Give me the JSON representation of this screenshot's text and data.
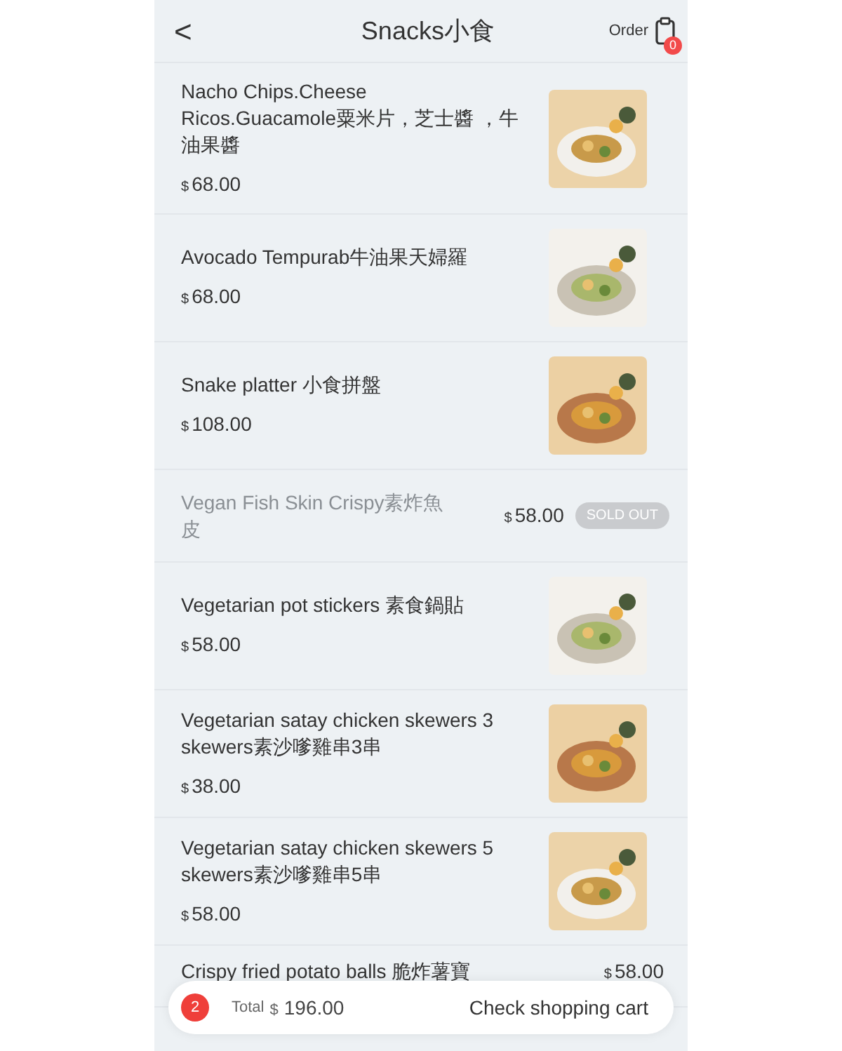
{
  "header": {
    "back": "<",
    "title": "Snacks小食",
    "order_label": "Order",
    "order_count": "0"
  },
  "items": [
    {
      "kind": "available",
      "name": "Nacho Chips.Cheese Ricos.Guacamole粟米片，芝士醬 ，牛油果醬",
      "currency": "$",
      "price": "68.00"
    },
    {
      "kind": "available",
      "name": "Avocado Tempurab牛油果天婦羅",
      "currency": "$",
      "price": "68.00"
    },
    {
      "kind": "available",
      "name": "Snake platter 小食拼盤",
      "currency": "$",
      "price": "108.00"
    },
    {
      "kind": "sold_out",
      "name": "Vegan Fish Skin Crispy素炸魚皮",
      "currency": "$",
      "price": "58.00",
      "badge": "SOLD OUT"
    },
    {
      "kind": "available",
      "name": "Vegetarian pot stickers 素食鍋貼",
      "currency": "$",
      "price": "58.00"
    },
    {
      "kind": "available",
      "name": "Vegetarian satay chicken skewers 3 skewers素沙嗲雞串3串",
      "currency": "$",
      "price": "38.00"
    },
    {
      "kind": "available",
      "name": "Vegetarian satay chicken skewers 5 skewers素沙嗲雞串5串",
      "currency": "$",
      "price": "58.00"
    },
    {
      "kind": "inline_price",
      "name": "Crispy fried potato balls 脆炸薯寶",
      "currency": "$",
      "price": "58.00"
    }
  ],
  "cart": {
    "count": "2",
    "total_label": "Total",
    "currency": "$",
    "total": "196.00",
    "action": "Check shopping cart"
  }
}
